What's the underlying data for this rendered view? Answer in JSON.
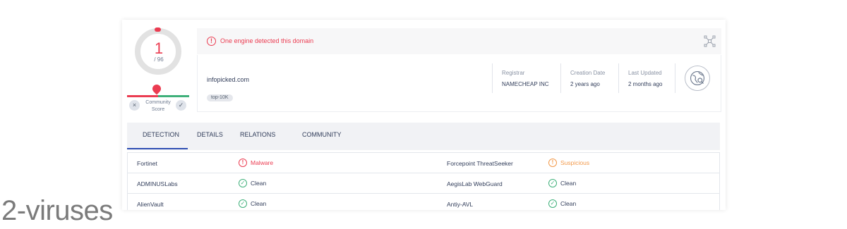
{
  "score": {
    "detections": "1",
    "total": "/ 96",
    "community_label": "Community Score",
    "vote_down_icon": "×",
    "vote_up_icon": "✓"
  },
  "alert": {
    "icon": "!",
    "text": "One engine detected this domain"
  },
  "domain": {
    "name": "infopicked.com",
    "tag": "top-10K"
  },
  "meta": [
    {
      "label": "Registrar",
      "value": "NAMECHEAP INC"
    },
    {
      "label": "Creation Date",
      "value": "2 years ago"
    },
    {
      "label": "Last Updated",
      "value": "2 months ago"
    }
  ],
  "tabs": [
    {
      "label": "DETECTION",
      "active": true
    },
    {
      "label": "DETAILS",
      "active": false
    },
    {
      "label": "RELATIONS",
      "active": false
    },
    {
      "label": "COMMUNITY",
      "active": false
    }
  ],
  "detections": [
    {
      "left": {
        "engine": "Fortinet",
        "verdict": "Malware",
        "kind": "malicious",
        "icon": "!"
      },
      "right": {
        "engine": "Forcepoint ThreatSeeker",
        "verdict": "Suspicious",
        "kind": "suspicious",
        "icon": "!"
      }
    },
    {
      "left": {
        "engine": "ADMINUSLabs",
        "verdict": "Clean",
        "kind": "clean",
        "icon": "✓"
      },
      "right": {
        "engine": "AegisLab WebGuard",
        "verdict": "Clean",
        "kind": "clean",
        "icon": "✓"
      }
    },
    {
      "left": {
        "engine": "AlienVault",
        "verdict": "Clean",
        "kind": "clean",
        "icon": "✓"
      },
      "right": {
        "engine": "Antiy-AVL",
        "verdict": "Clean",
        "kind": "clean",
        "icon": "✓"
      }
    }
  ],
  "colors": {
    "malicious": "#eb3c51",
    "suspicious": "#f2994a",
    "clean": "#3fb07a",
    "tab_active": "#2f4fb3"
  },
  "watermark": "2-viruses"
}
